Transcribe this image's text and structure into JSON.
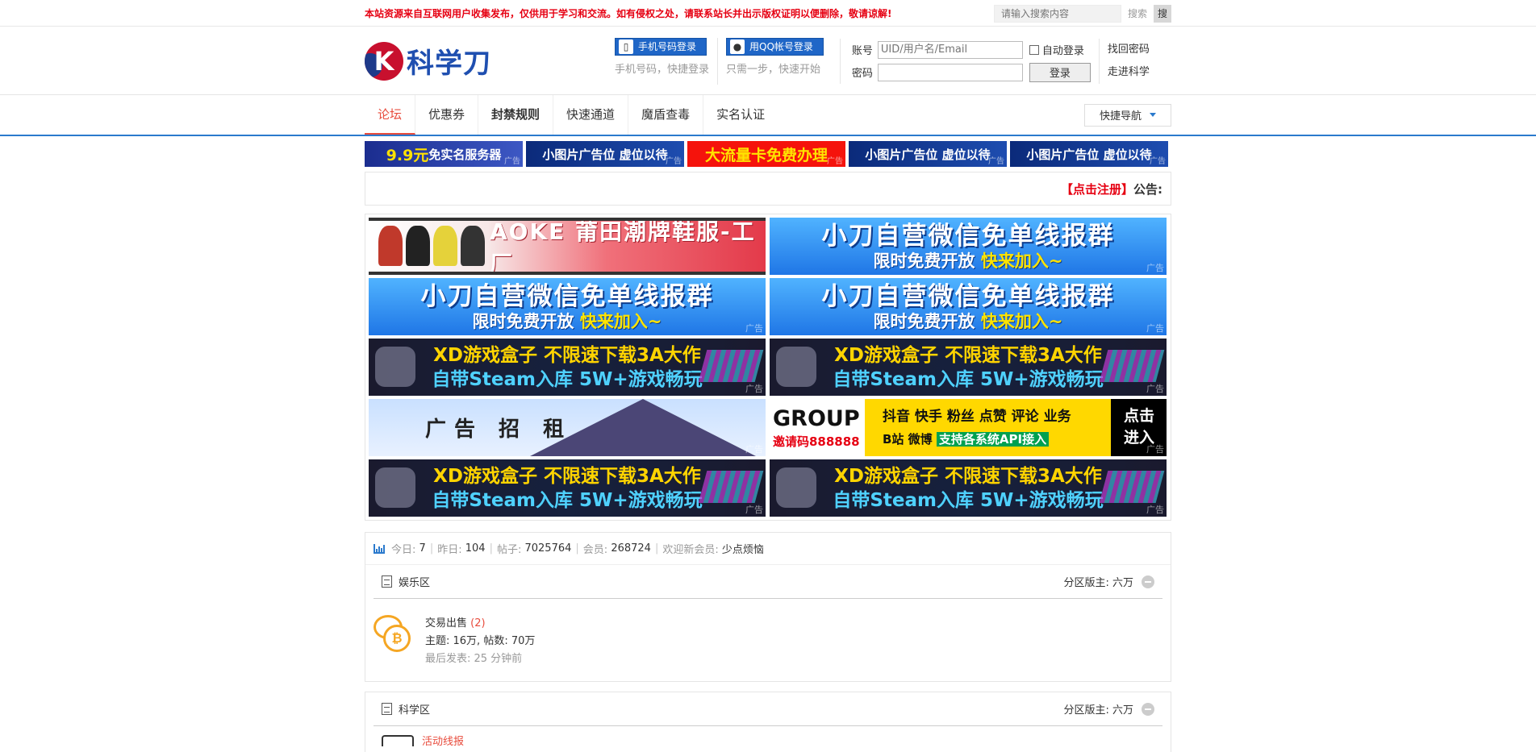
{
  "topbar": {
    "notice": "本站资源来自互联网用户收集发布，仅供用于学习和交流。如有侵权之处，请联系站长并出示版权证明以便删除，敬请谅解!",
    "search_placeholder": "请输入搜索内容",
    "search_label": "搜索",
    "search_button": "搜"
  },
  "header": {
    "logo_letter": "K",
    "logo_text": "科学刀",
    "phone_login": "手机号码登录",
    "phone_sub": "手机号码，快捷登录",
    "qq_login": "用QQ帐号登录",
    "qq_sub": "只需一步，快速开始",
    "account_label": "账号",
    "account_placeholder": "UID/用户名/Email",
    "auto_login": "自动登录",
    "password_label": "密码",
    "login_button": "登录",
    "find_password": "找回密码",
    "enter_site": "走进科学"
  },
  "nav": {
    "items": [
      "论坛",
      "优惠券",
      "封禁规则",
      "快速通道",
      "魔盾查毒",
      "实名认证"
    ],
    "quick_nav": "快捷导航"
  },
  "small_ads": {
    "ad1_prefix": "9.9元",
    "ad1_suffix": "免实名服务器",
    "ad2": "小图片广告位 虚位以待",
    "ad3": "大流量卡免费办理",
    "ad4": "小图片广告位 虚位以待",
    "ad5": "小图片广告位 虚位以待",
    "tag": "广告"
  },
  "announce": {
    "register": "【点击注册】",
    "label": "公告:"
  },
  "big_ads": {
    "tag": "广告",
    "shoe": "AOKE 莆田潮牌鞋服-工厂",
    "wx_line1": "小刀自营微信免单线报群",
    "wx_line2a": "限时免费开放 ",
    "wx_line2b": "快来加入~",
    "xd_line1": "XD游戏盒子 不限速下载3A大作",
    "xd_line2": "自带Steam入库 5W+游戏畅玩",
    "rent": "广告 招 租",
    "group_big": "GROUP",
    "group_invite": "邀请码888888",
    "group_a": "抖音 快手 粉丝 点赞 评论 业务",
    "group_b1": "B站 微博 ",
    "group_b2": "支持各系统API接入",
    "group_c": "点击进入"
  },
  "stats": {
    "today_label": "今日:",
    "today": "7",
    "yesterday_label": "昨日:",
    "yesterday": "104",
    "posts_label": "帖子:",
    "posts": "7025764",
    "members_label": "会员:",
    "members": "268724",
    "welcome_label": "欢迎新会员:",
    "new_member": "少点烦恼"
  },
  "categories": [
    {
      "name": "娱乐区",
      "moderator_label": "分区版主:",
      "moderator": "六万",
      "boards": [
        {
          "name": "交易出售",
          "count": "(2)",
          "meta": "主题: 16万, 帖数: 70万",
          "last": "最后发表: 25 分钟前"
        }
      ]
    },
    {
      "name": "科学区",
      "moderator_label": "分区版主:",
      "moderator": "六万",
      "peek": "活动线报"
    }
  ],
  "colors": {
    "accent": "#2b7acd",
    "notice": "#e60012",
    "active_nav": "#e84c3d"
  }
}
